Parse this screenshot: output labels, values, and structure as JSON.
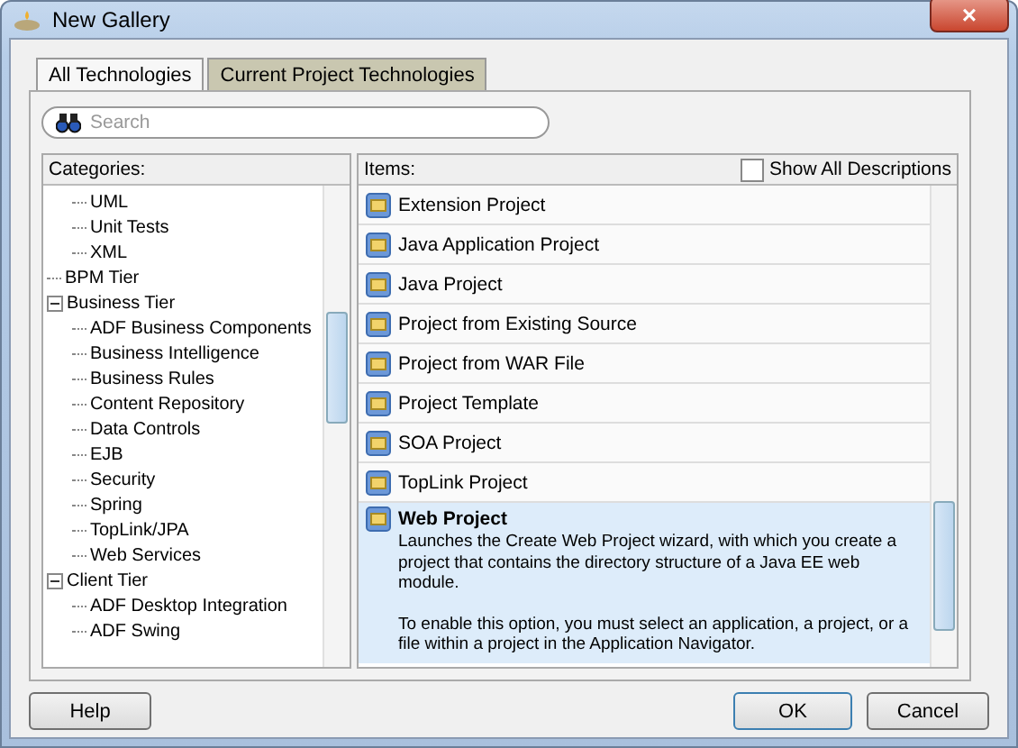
{
  "window": {
    "title": "New Gallery",
    "close": "×"
  },
  "tabs": [
    {
      "label": "All Technologies",
      "selected": true
    },
    {
      "label": "Current Project Technologies",
      "selected": false
    }
  ],
  "search": {
    "placeholder": "Search"
  },
  "categories": {
    "label": "Categories:",
    "items": [
      {
        "children": [
          {
            "label": "UML"
          },
          {
            "label": "Unit Tests"
          },
          {
            "label": "XML"
          }
        ]
      },
      {
        "label": "BPM Tier"
      },
      {
        "label": "Business Tier",
        "expanded": true,
        "children": [
          {
            "label": "ADF Business Components"
          },
          {
            "label": "Business Intelligence"
          },
          {
            "label": "Business Rules"
          },
          {
            "label": "Content Repository"
          },
          {
            "label": "Data Controls"
          },
          {
            "label": "EJB"
          },
          {
            "label": "Security"
          },
          {
            "label": "Spring"
          },
          {
            "label": "TopLink/JPA"
          },
          {
            "label": "Web Services"
          }
        ]
      },
      {
        "label": "Client Tier",
        "expanded": true,
        "children": [
          {
            "label": "ADF Desktop Integration"
          },
          {
            "label": "ADF Swing"
          }
        ]
      }
    ]
  },
  "items": {
    "label": "Items:",
    "show_all_descriptions": {
      "label": "Show All Descriptions",
      "checked": false
    },
    "list": [
      {
        "name": "Extension Project",
        "selected": false
      },
      {
        "name": "Java Application Project",
        "selected": false
      },
      {
        "name": "Java Project",
        "selected": false
      },
      {
        "name": "Project from Existing Source",
        "selected": false
      },
      {
        "name": "Project from WAR File",
        "selected": false
      },
      {
        "name": "Project Template",
        "selected": false
      },
      {
        "name": "SOA Project",
        "selected": false
      },
      {
        "name": "TopLink Project",
        "selected": false
      },
      {
        "name": "Web Project",
        "selected": true,
        "description": [
          "Launches the Create Web Project wizard, with which you create a project that contains the directory structure of a Java EE web module.",
          "To enable this option, you must select an application, a project, or a file within a project in the Application Navigator."
        ]
      }
    ]
  },
  "buttons": {
    "help": "Help",
    "ok": "OK",
    "cancel": "Cancel"
  }
}
